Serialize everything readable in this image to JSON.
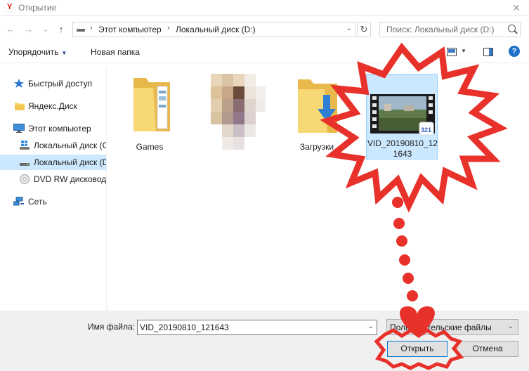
{
  "window": {
    "title": "Открытие",
    "close_glyph": "✕"
  },
  "nav": {
    "back_glyph": "←",
    "forward_glyph": "→",
    "history_glyph": "⌄",
    "up_glyph": "↑",
    "breadcrumb": [
      "Этот компьютер",
      "Локальный диск (D:)"
    ],
    "refresh_glyph": "↻",
    "search_placeholder": "Поиск: Локальный диск (D:)"
  },
  "toolbar": {
    "organize_label": "Упорядочить",
    "new_folder_label": "Новая папка",
    "help_glyph": "?"
  },
  "sidebar": {
    "items": [
      {
        "label": "Быстрый доступ",
        "icon": "star-icon"
      },
      {
        "label": "Яндекс.Диск",
        "icon": "folder-icon"
      },
      {
        "label": "Этот компьютер",
        "icon": "computer-icon"
      },
      {
        "label": "Локальный диск (C",
        "icon": "windows-drive-icon"
      },
      {
        "label": "Локальный диск (D",
        "icon": "drive-icon",
        "selected": true
      },
      {
        "label": "DVD RW дисковод (",
        "icon": "dvd-icon"
      },
      {
        "label": "Сеть",
        "icon": "network-icon"
      }
    ]
  },
  "files": [
    {
      "name": "Games",
      "type": "folder"
    },
    {
      "name": "",
      "type": "blurred"
    },
    {
      "name": "Загрузки",
      "type": "downloads-folder"
    },
    {
      "name": "VID_20190810_121643",
      "name_line1": "VID_20190810_12",
      "name_line2": "1643",
      "type": "video",
      "selected": true
    }
  ],
  "footer": {
    "filename_label": "Имя файла:",
    "filename_value": "VID_20190810_121643",
    "filetype_value": "Пользовательские файлы",
    "open_label": "Открыть",
    "cancel_label": "Отмена"
  },
  "colors": {
    "selection_bg": "#cce8ff",
    "highlight_red": "#e8312a",
    "folder_yellow": "#f8d775",
    "accent_blue": "#0078d7"
  }
}
